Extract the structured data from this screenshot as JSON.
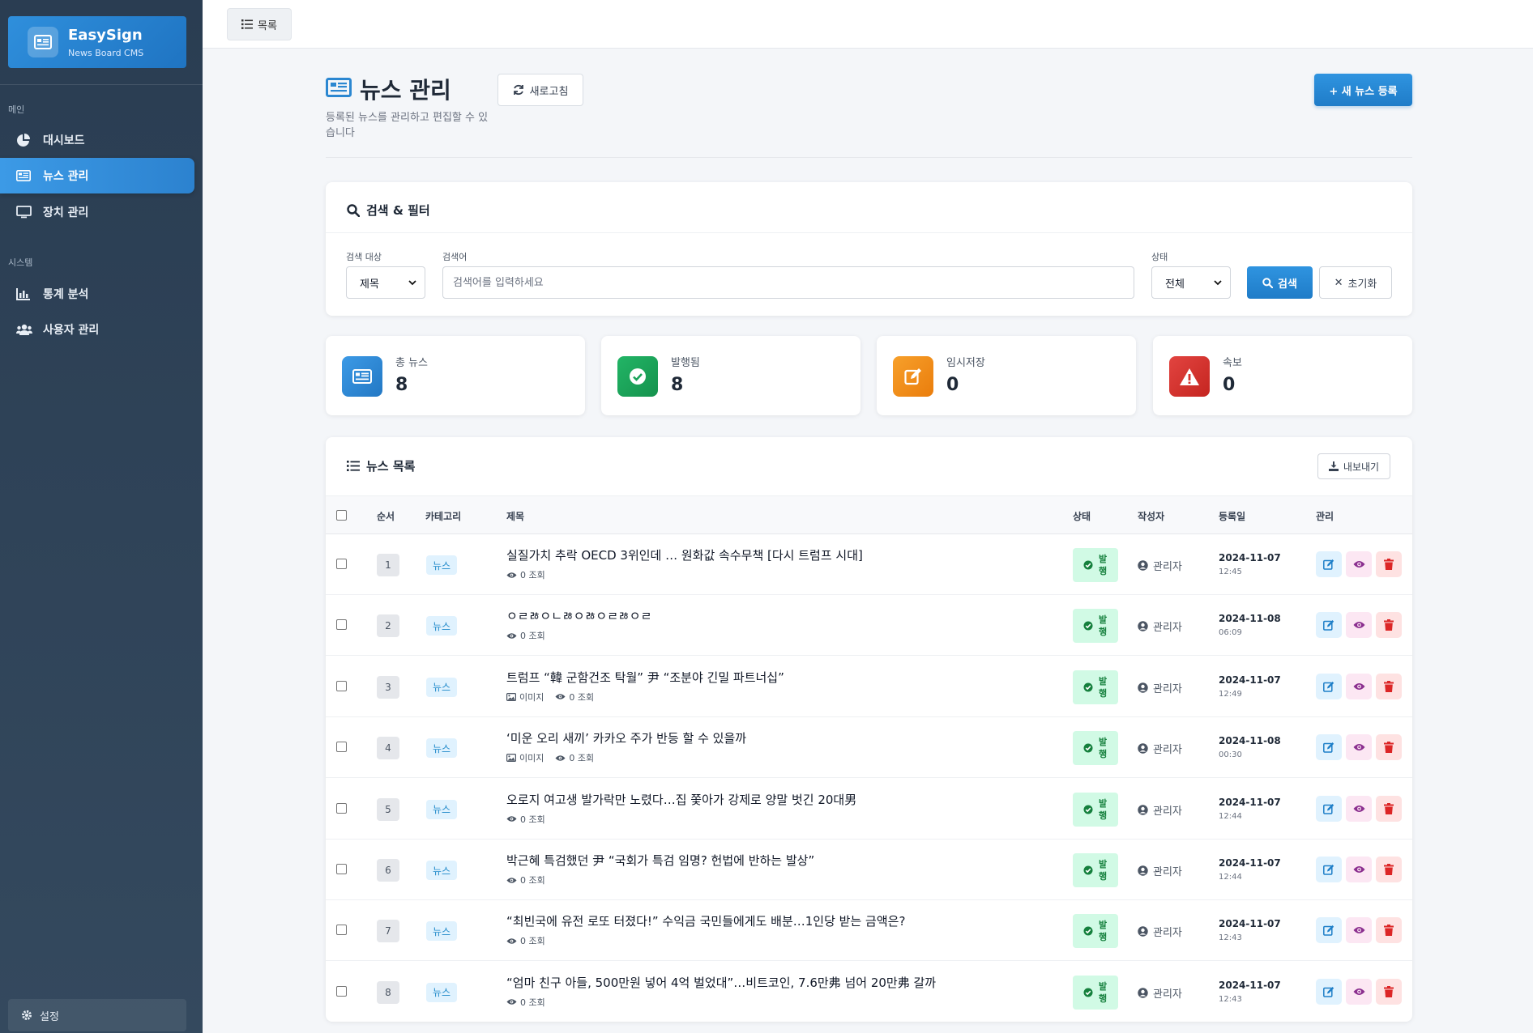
{
  "brand": {
    "title": "EasySign",
    "subtitle": "News Board CMS"
  },
  "sidebar": {
    "sections": [
      {
        "label": "메인",
        "items": [
          "대시보드",
          "뉴스 관리",
          "장치 관리"
        ]
      },
      {
        "label": "시스템",
        "items": [
          "통계 분석",
          "사용자 관리"
        ]
      }
    ],
    "settings": "설정"
  },
  "topbar": {
    "list_button": "목록"
  },
  "page": {
    "title": "뉴스 관리",
    "description": "등록된 뉴스를 관리하고 편집할 수 있습니다",
    "refresh": "새로고침",
    "new_button": "+ 새 뉴스 등록"
  },
  "search": {
    "title": "검색 & 필터",
    "target_label": "검색 대상",
    "target_value": "제목",
    "keyword_label": "검색어",
    "keyword_placeholder": "검색어를 입력하세요",
    "status_label": "상태",
    "status_value": "전체",
    "search_button": "검색",
    "reset_button": "초기화"
  },
  "stats": [
    {
      "label": "총 뉴스",
      "value": "8",
      "color": "#2b87d1"
    },
    {
      "label": "발행됨",
      "value": "8",
      "color": "#1aa35a"
    },
    {
      "label": "임시저장",
      "value": "0",
      "color": "#f08a12"
    },
    {
      "label": "속보",
      "value": "0",
      "color": "#d6302b"
    }
  ],
  "news_list": {
    "title": "뉴스 목록",
    "export": "내보내기",
    "headers": {
      "order": "순서",
      "category": "카테고리",
      "title": "제목",
      "status": "상태",
      "author": "작성자",
      "date": "등록일",
      "manage": "관리"
    },
    "rows": [
      {
        "no": "1",
        "category": "뉴스",
        "title": "실질가치 추락 OECD 3위인데 … 원화값 속수무책 [다시 트럼프 시대]",
        "image": "",
        "views": "0 조회",
        "status": "발행",
        "author": "관리자",
        "date": "2024-11-07",
        "time": "12:45"
      },
      {
        "no": "2",
        "category": "뉴스",
        "title": "ㅇㄹㅀㅇㄴㅀㅇㅀㅇㄹㅀㅇㄹ",
        "image": "",
        "views": "0 조회",
        "status": "발행",
        "author": "관리자",
        "date": "2024-11-08",
        "time": "06:09"
      },
      {
        "no": "3",
        "category": "뉴스",
        "title": "트럼프 “韓 군함건조 탁월” 尹 “조분야 긴밀 파트너십”",
        "image": "이미지",
        "views": "0 조회",
        "status": "발행",
        "author": "관리자",
        "date": "2024-11-07",
        "time": "12:49"
      },
      {
        "no": "4",
        "category": "뉴스",
        "title": "‘미운 오리 새끼’ 카카오 주가 반등 할 수 있을까",
        "image": "이미지",
        "views": "0 조회",
        "status": "발행",
        "author": "관리자",
        "date": "2024-11-08",
        "time": "00:30"
      },
      {
        "no": "5",
        "category": "뉴스",
        "title": "오로지 여고생 발가락만 노렸다…집 쫓아가 강제로 양말 벗긴 20대男",
        "image": "",
        "views": "0 조회",
        "status": "발행",
        "author": "관리자",
        "date": "2024-11-07",
        "time": "12:44"
      },
      {
        "no": "6",
        "category": "뉴스",
        "title": "박근혜 특검했던 尹 “국회가 특검 임명? 헌법에 반하는 발상”",
        "image": "",
        "views": "0 조회",
        "status": "발행",
        "author": "관리자",
        "date": "2024-11-07",
        "time": "12:44"
      },
      {
        "no": "7",
        "category": "뉴스",
        "title": "“최빈국에 유전 로또 터졌다!” 수익금 국민들에게도 배분…1인당 받는 금액은?",
        "image": "",
        "views": "0 조회",
        "status": "발행",
        "author": "관리자",
        "date": "2024-11-07",
        "time": "12:43"
      },
      {
        "no": "8",
        "category": "뉴스",
        "title": "“엄마 친구 아들, 500만원 넣어 4억 벌었대”…비트코인, 7.6만弗 넘어 20만弗 갈까",
        "image": "",
        "views": "0 조회",
        "status": "발행",
        "author": "관리자",
        "date": "2024-11-07",
        "time": "12:43"
      }
    ]
  },
  "colors": {
    "accent": "#2f8fdc",
    "sidebar": "#2f4256",
    "success": "#15803d",
    "danger": "#dc2626"
  }
}
